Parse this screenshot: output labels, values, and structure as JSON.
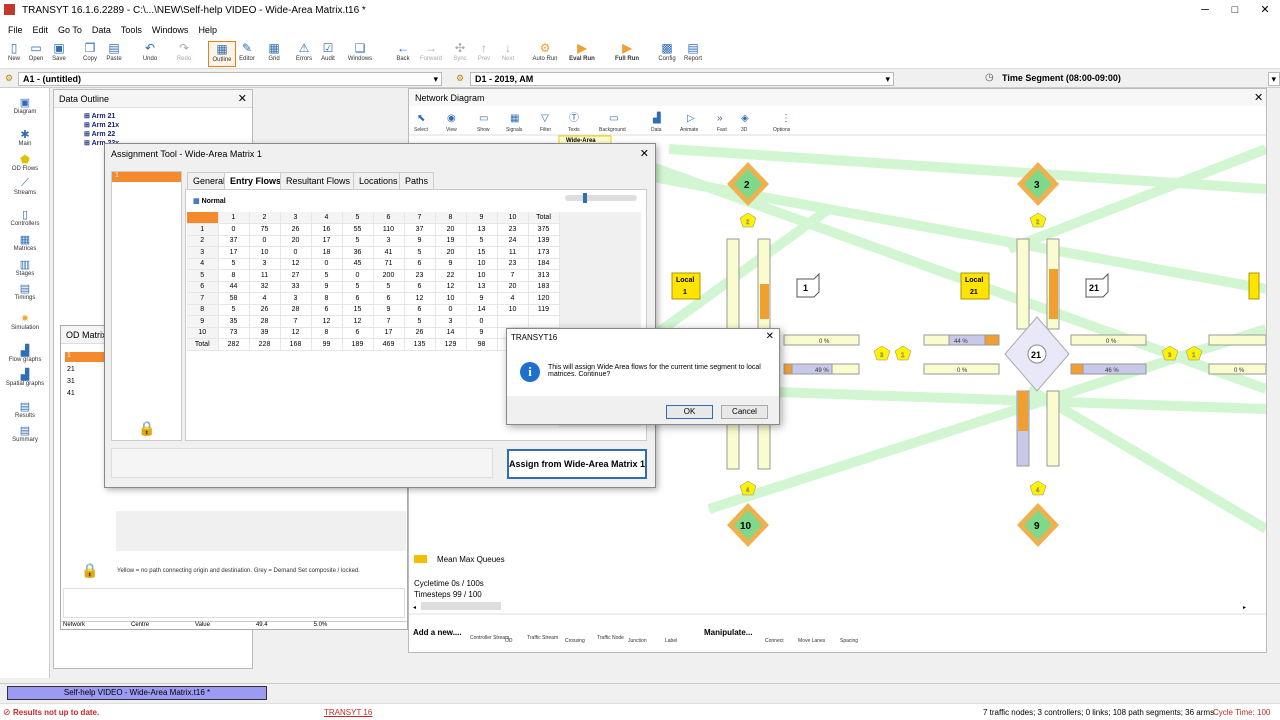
{
  "window": {
    "title": "TRANSYT 16.1.6.2289 - C:\\...\\NEW\\Self-help VIDEO - Wide-Area Matrix.t16 *"
  },
  "menu": [
    "File",
    "Edit",
    "Go To",
    "Data",
    "Tools",
    "Windows",
    "Help"
  ],
  "toolbar": {
    "new": "New",
    "open": "Open",
    "save": "Save",
    "copy": "Copy",
    "paste": "Paste",
    "undo": "Undo",
    "redo": "Redo",
    "outline": "Outline",
    "editor": "Editor",
    "grid": "Grid",
    "errors": "Errors",
    "audit": "Audit",
    "windows": "Windows",
    "back": "Back",
    "forward": "Forward",
    "sync": "Sync",
    "prev": "Prev",
    "next": "Next",
    "autorun": "Auto Run",
    "evalrun": "Eval Run",
    "fullrun": "Full Run",
    "config": "Config",
    "report": "Report"
  },
  "context": {
    "analysis": "A1 - (untitled)",
    "demand": "D1 - 2019, AM",
    "timeseg": "Time Segment (08:00-09:00)"
  },
  "sidebar": [
    "Diagram",
    "Main",
    "OD Flows",
    "Streams",
    "Controllers",
    "Matrices",
    "Stages",
    "Timings",
    "Simulation",
    "Flow graphs",
    "Spatial graphs",
    "Results",
    "Summary"
  ],
  "outline": {
    "title": "Data Outline",
    "items": [
      "Arm 21",
      "Arm 21x",
      "Arm 22",
      "Arm 22x"
    ]
  },
  "odmatrix": {
    "title": "OD Matrix",
    "rows": [
      "1",
      "21",
      "31",
      "41"
    ],
    "footnote": "Yellow = no path connecting origin and destination.  Grey = Demand Set composite / locked.",
    "bottom": [
      "Network",
      "Centre",
      "Value",
      "49.4",
      "5.0%"
    ]
  },
  "assign": {
    "title": "Assignment Tool - Wide-Area Matrix 1",
    "left_item": "1",
    "tabs": [
      "General",
      "Entry Flows",
      "Resultant Flows",
      "Locations",
      "Paths"
    ],
    "normal": "Normal",
    "headers": [
      "1",
      "2",
      "3",
      "4",
      "5",
      "6",
      "7",
      "8",
      "9",
      "10",
      "Total"
    ],
    "rowlabels": [
      "1",
      "2",
      "3",
      "4",
      "5",
      "6",
      "7",
      "8",
      "9",
      "10",
      "Total"
    ],
    "rows": [
      [
        "0",
        "75",
        "26",
        "16",
        "55",
        "110",
        "37",
        "20",
        "13",
        "23",
        "375"
      ],
      [
        "37",
        "0",
        "20",
        "17",
        "5",
        "3",
        "9",
        "19",
        "5",
        "24",
        "139"
      ],
      [
        "17",
        "10",
        "0",
        "18",
        "36",
        "41",
        "5",
        "20",
        "15",
        "11",
        "173"
      ],
      [
        "5",
        "3",
        "12",
        "0",
        "45",
        "71",
        "6",
        "9",
        "10",
        "23",
        "184"
      ],
      [
        "8",
        "11",
        "27",
        "5",
        "0",
        "200",
        "23",
        "22",
        "10",
        "7",
        "313"
      ],
      [
        "44",
        "32",
        "33",
        "9",
        "5",
        "5",
        "6",
        "12",
        "13",
        "20",
        "183"
      ],
      [
        "58",
        "4",
        "3",
        "8",
        "6",
        "6",
        "12",
        "10",
        "9",
        "4",
        "120"
      ],
      [
        "5",
        "26",
        "28",
        "6",
        "15",
        "9",
        "6",
        "0",
        "14",
        "10",
        "119"
      ],
      [
        "35",
        "28",
        "7",
        "12",
        "12",
        "7",
        "5",
        "3",
        "0",
        "",
        ""
      ],
      [
        "73",
        "39",
        "12",
        "8",
        "6",
        "17",
        "26",
        "14",
        "9",
        "",
        ""
      ],
      [
        "282",
        "228",
        "168",
        "99",
        "189",
        "469",
        "135",
        "129",
        "98",
        "",
        ""
      ]
    ],
    "assign_button": "Assign from Wide-Area Matrix 1"
  },
  "msgbox": {
    "title": "TRANSYT16",
    "text": "This will assign Wide Area flows for the current time segment to local matrices. Continue?",
    "ok": "OK",
    "cancel": "Cancel"
  },
  "network": {
    "title": "Network Diagram",
    "tools": [
      "Select",
      "View",
      "Show",
      "Signals",
      "Filter",
      "Texts",
      "Background",
      "Data",
      "Animate",
      "Fast",
      "3D",
      "Options"
    ],
    "label_wide_area": "Wide-Area",
    "nodes": [
      "2",
      "3",
      "10",
      "9"
    ],
    "junctions": [
      "21"
    ],
    "locals": [
      "Local\n1",
      "Local\n21"
    ],
    "boxes": [
      "1",
      "21"
    ],
    "arms": [
      "0 %",
      "44 %",
      "0 %",
      "49 %",
      "0 %",
      "46 %",
      "0 %"
    ],
    "legend": "Mean Max Queues",
    "cycletime": "Cycletime 0s / 100s",
    "timesteps": "Timesteps 99 / 100",
    "add_new": "Add a new....",
    "add_items": [
      "Controller Stream",
      "OD",
      "Traffic Stream",
      "Crossing",
      "Traffic Node",
      "Junction",
      "Label"
    ],
    "manipulate": "Manipulate...",
    "manip_items": [
      "Connect",
      "Move Lanes",
      "Spacing"
    ]
  },
  "status": {
    "file": "Self-help VIDEO - Wide-Area Matrix.t16 *",
    "results": "Results not up to date.",
    "product": "TRANSYT 16",
    "summary": "7 traffic nodes; 3 controllers; 0 links; 108 path segments; 36 arms",
    "cycle": "Cycle Time: 100"
  },
  "colors": {
    "accent": "#f48a2c",
    "node_green": "#7ed98a",
    "node_orange": "#f0a030",
    "node_yellow": "#fff200",
    "local_yellow": "#ffe400",
    "status_red": "#c62828",
    "file_tab": "#9b9bf5"
  }
}
